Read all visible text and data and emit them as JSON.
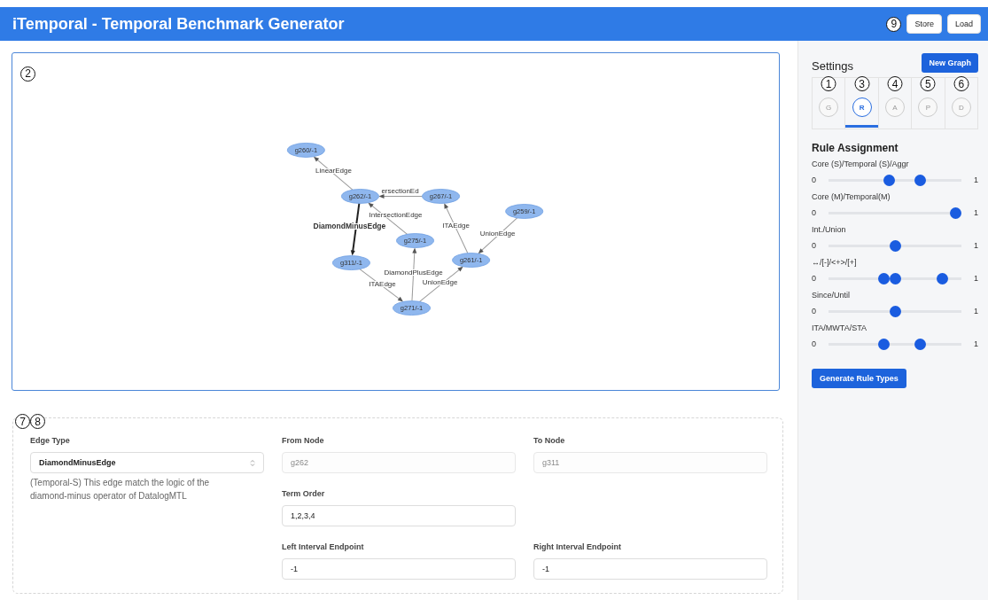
{
  "header": {
    "title": "iTemporal - Temporal Benchmark Generator",
    "callout": "9",
    "buttons": [
      "Store",
      "Load"
    ]
  },
  "graph": {
    "callout": "2",
    "nodes": [
      {
        "label": "g260/-1"
      },
      {
        "label": "g262/-1"
      },
      {
        "label": "g267/-1"
      },
      {
        "label": "g259/-1"
      },
      {
        "label": "g275/-1"
      },
      {
        "label": "g311/-1"
      },
      {
        "label": "g261/-1"
      },
      {
        "label": "g271/-1"
      }
    ],
    "edges": [
      {
        "label": "LinearEdge",
        "selected": false
      },
      {
        "label": "ersectionEd",
        "selected": false
      },
      {
        "label": "IntersectionEdge",
        "selected": false
      },
      {
        "label": "DiamondMinusEdge",
        "selected": true
      },
      {
        "label": "ITAEdge",
        "selected": false
      },
      {
        "label": "UnionEdge",
        "selected": false
      },
      {
        "label": "DiamondPlusEdge",
        "selected": false
      },
      {
        "label": "ITAEdge",
        "selected": false
      },
      {
        "label": "UnionEdge",
        "selected": false
      }
    ]
  },
  "edge_form": {
    "callouts": [
      "7",
      "8"
    ],
    "edge_type": {
      "label": "Edge Type",
      "value": "DiamondMinusEdge",
      "description": "(Temporal-S) This edge match the logic of the diamond-minus operator of DatalogMTL"
    },
    "fields": [
      {
        "label": "From Node",
        "value": "g262",
        "disabled": true
      },
      {
        "label": "To Node",
        "value": "g311",
        "disabled": true
      },
      {
        "label": "Term Order",
        "value": "1,2,3,4",
        "disabled": false
      },
      {
        "label": "Left Interval Endpoint",
        "value": "-1",
        "disabled": false
      },
      {
        "label": "Right Interval Endpoint",
        "value": "-1",
        "disabled": false
      }
    ]
  },
  "settings": {
    "title": "Settings",
    "new_graph_button": "New Graph",
    "steps": [
      {
        "label": "G",
        "callout": "1",
        "selected": false
      },
      {
        "label": "R",
        "callout": "3",
        "selected": true
      },
      {
        "label": "A",
        "callout": "4",
        "selected": false
      },
      {
        "label": "P",
        "callout": "5",
        "selected": false
      },
      {
        "label": "D",
        "callout": "6",
        "selected": false
      }
    ],
    "section_title": "Rule Assignment",
    "sliders": [
      {
        "label": "Core (S)/Temporal (S)/Aggr",
        "min": "0",
        "max": "1",
        "thumbs": [
          {
            "level": 0.45
          },
          {
            "level": 0.71
          }
        ]
      },
      {
        "label": "Core (M)/Temporal(M)",
        "min": "0",
        "max": "1",
        "thumbs": [
          {
            "level": 1.0
          }
        ]
      },
      {
        "label": "Int./Union",
        "min": "0",
        "max": "1",
        "thumbs": [
          {
            "level": 0.5
          }
        ]
      },
      {
        "label": "↔/[-]/<+>/[+]",
        "min": "0",
        "max": "1",
        "thumbs": [
          {
            "level": 0.41
          },
          {
            "level": 0.5
          },
          {
            "level": 0.89
          }
        ]
      },
      {
        "label": "Since/Until",
        "min": "0",
        "max": "1",
        "thumbs": [
          {
            "level": 0.5
          }
        ]
      },
      {
        "label": "ITA/MWTA/STA",
        "min": "0",
        "max": "1",
        "thumbs": [
          {
            "level": 0.41
          },
          {
            "level": 0.71
          }
        ]
      }
    ],
    "generate_button": "Generate Rule Types"
  }
}
